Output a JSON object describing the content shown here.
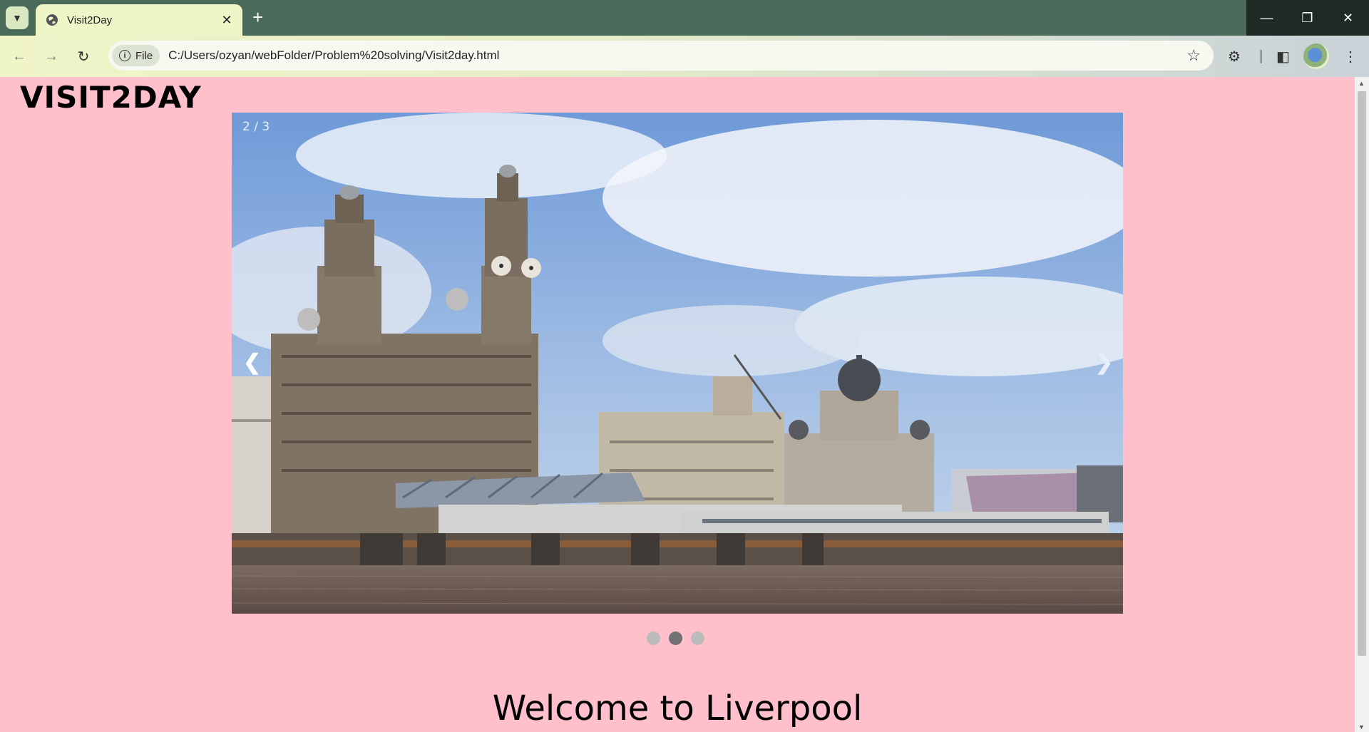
{
  "browser": {
    "tab_title": "Visit2Day",
    "url": "C:/Users/ozyan/webFolder/Problem%20solving/Visit2day.html",
    "site_info_label": "File"
  },
  "page": {
    "logo": "VISIT2DAY",
    "slideshow": {
      "counter": "2 / 3",
      "prev_label": "❮",
      "next_label": "❯",
      "dots": 3,
      "active_dot": 2
    },
    "heading": "Welcome to Liverpool"
  }
}
